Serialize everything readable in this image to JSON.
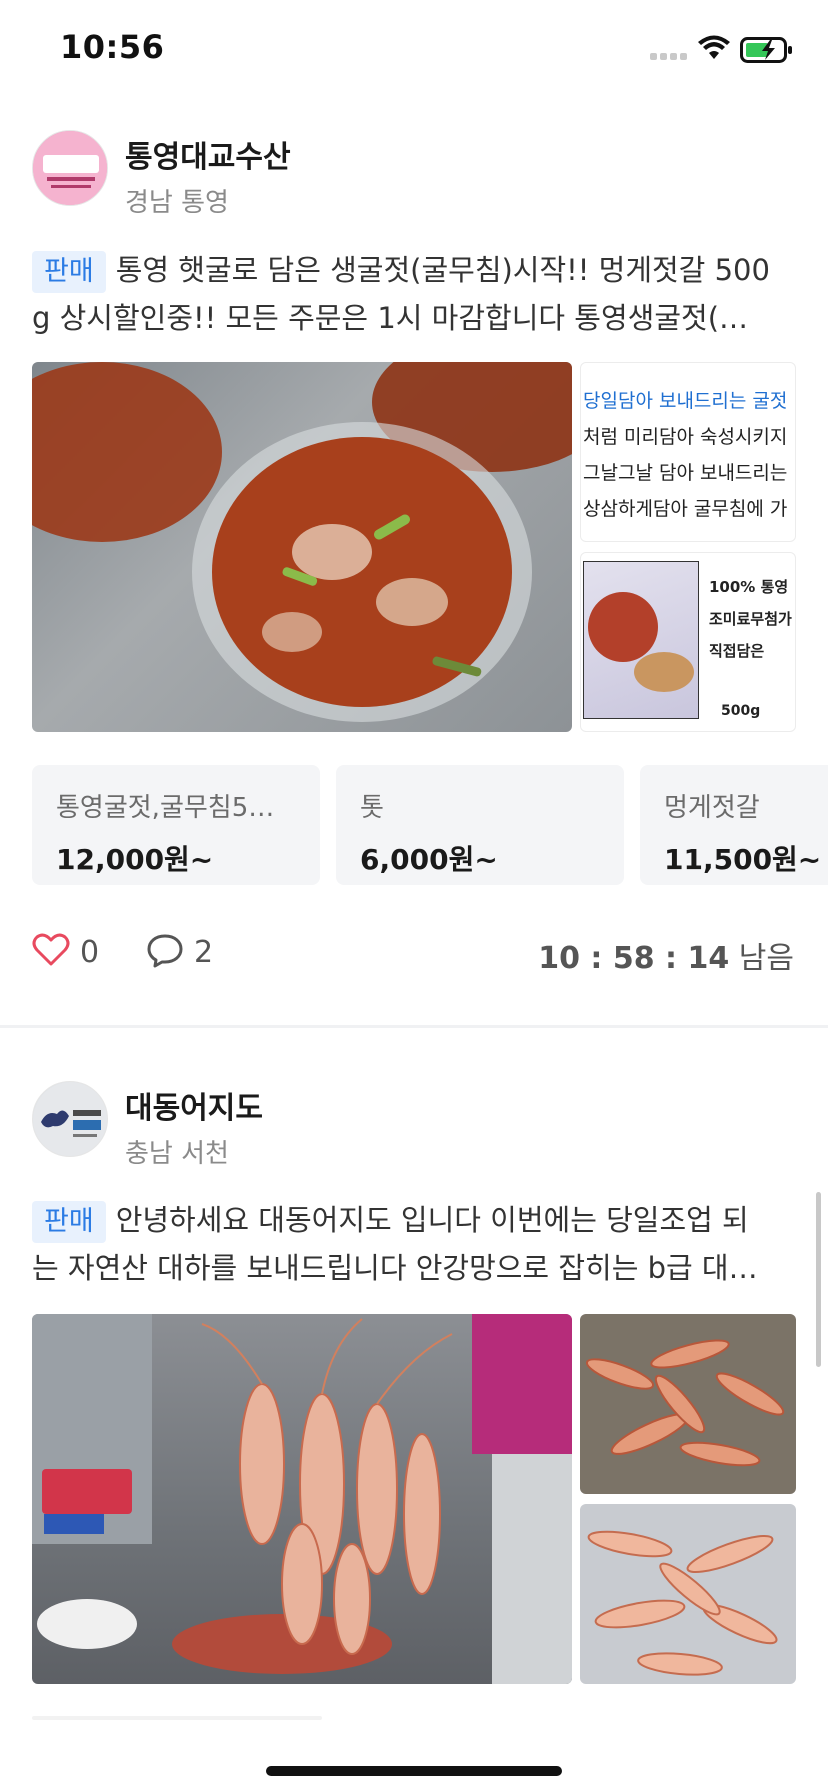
{
  "status_bar": {
    "time": "10:56"
  },
  "posts": [
    {
      "seller_name": "통영대교수산",
      "location": "경남 통영",
      "avatar_text": "통영대교수산",
      "badge": "판매",
      "text_line1": "통영 햇굴로 담은 생굴젓(굴무침)시작!! 멍게젓갈 500",
      "text_line2": "g 상시할인중!! 모든 주문은 1시 마감합니다 통영생굴젓(…",
      "thumb1_lines": [
        "당일담아 보내드리는 굴젓",
        "처럼 미리담아 숙성시키지",
        "그날그날 담아 보내드리는",
        "상삼하게담아 굴무침에 가"
      ],
      "thumb2_lines": [
        "100% 통영",
        "조미료무첨가",
        "직접담은",
        "500g"
      ],
      "products": [
        {
          "name": "통영굴젓,굴무침5…",
          "price": "12,000원~"
        },
        {
          "name": "톳",
          "price": "6,000원~"
        },
        {
          "name": "멍게젓갈",
          "price": "11,500원~"
        }
      ],
      "likes": "0",
      "comments": "2",
      "timer_h": "10",
      "timer_m": "58",
      "timer_s": "14",
      "timer_suffix": "남음"
    },
    {
      "seller_name": "대동어지도",
      "location": "충남 서천",
      "avatar_text": "대동어지",
      "badge": "판매",
      "text_line1": "안녕하세요 대동어지도 입니다 이번에는 당일조업 되",
      "text_line2": "는 자연산 대하를 보내드립니다 안강망으로 잡히는 b급 대…"
    }
  ],
  "colors": {
    "badge_bg": "#e8f1fd",
    "badge_text": "#2b7be4",
    "like_icon": "#e84a5f"
  },
  "icons": [
    "signal-icon",
    "wifi-icon",
    "battery-charging-icon",
    "heart-icon",
    "comment-icon"
  ]
}
